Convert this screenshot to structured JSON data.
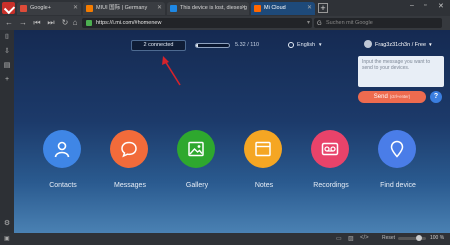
{
  "tabs": [
    {
      "label": "Google+",
      "color": "#dd4b39"
    },
    {
      "label": "MIUI 国际 | Germany",
      "color": "#f57c00"
    },
    {
      "label": "This device is lost, dieses g",
      "color": "#1e88e5"
    },
    {
      "label": "Mi Cloud",
      "color": "#ff6700"
    }
  ],
  "address": {
    "url": "https://i.mi.com/#homenew",
    "search_placeholder": "Suchen mit Google"
  },
  "header": {
    "connected": "2 connected",
    "storage": "5.32 / 110",
    "storage_fraction": 0.05,
    "language": "English",
    "user": "Frag3z31ch3n / Free"
  },
  "message": {
    "placeholder": "Input the message you want to send to your devices.",
    "send_label": "Send",
    "send_hint": "(ctrl+enter)",
    "help": "?"
  },
  "apps": [
    {
      "label": "Contacts",
      "color": "#3f86e6"
    },
    {
      "label": "Messages",
      "color": "#f26b3a"
    },
    {
      "label": "Gallery",
      "color": "#2ea82e"
    },
    {
      "label": "Notes",
      "color": "#f5a623"
    },
    {
      "label": "Recordings",
      "color": "#e8436a"
    },
    {
      "label": "Find device",
      "color": "#4a7de8"
    }
  ],
  "status": {
    "reset": "Reset",
    "zoom": "100 %"
  }
}
